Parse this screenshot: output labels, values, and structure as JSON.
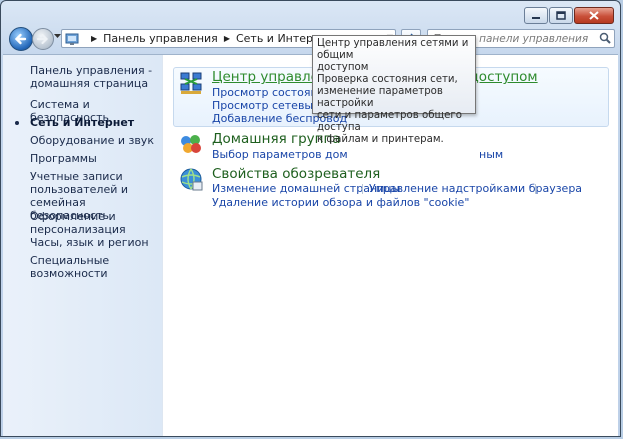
{
  "window": {
    "caption_buttons": [
      "minimize-icon",
      "maximize-icon",
      "close-icon"
    ]
  },
  "nav": {
    "breadcrumbs": [
      "Панель управления",
      "Сеть и Интернет"
    ],
    "search_placeholder": "Поиск в панели управления",
    "icons": [
      "back-arrow-icon",
      "forward-arrow-icon",
      "refresh-icon",
      "search-icon",
      "control-panel-icon"
    ]
  },
  "sidebar": {
    "items": [
      {
        "label": "Панель управления -",
        "label2": "домашняя страница"
      },
      {
        "label": "Система и безопасность"
      },
      {
        "label": "Сеть и Интернет"
      },
      {
        "label": "Оборудование и звук"
      },
      {
        "label": "Программы"
      },
      {
        "label": "Учетные записи",
        "label2": "пользователей и семейная",
        "label3": "безопасность"
      },
      {
        "label": "Оформление и",
        "label2": "персонализация"
      },
      {
        "label": "Часы, язык и регион"
      },
      {
        "label": "Специальные возможности"
      }
    ],
    "active_index": 2
  },
  "sections": [
    {
      "title": "Центр управления сетями и общим доступом",
      "icon": "network-center-icon",
      "links": [
        "Просмотр состояния се",
        "Просмотр сетевых комп",
        "Добавление беспровод"
      ]
    },
    {
      "title": "Домашняя группа",
      "icon": "homegroup-icon",
      "links": [
        "Выбор параметров дом",
        "ным"
      ]
    },
    {
      "title": "Свойства обозревателя",
      "icon": "internet-options-icon",
      "links": [
        "Изменение домашней страницы",
        "Управление надстройками браузера",
        "Удаление истории обзора и файлов \"cookie\""
      ]
    }
  ],
  "tooltip": {
    "lines": [
      "Центр управления сетями и общим",
      "доступом",
      "Проверка состояния сети,",
      "изменение параметров настройки",
      "сети и параметров общего доступа",
      "к файлам и принтерам."
    ]
  },
  "colors": {
    "link": "#1a46a8",
    "section_title": "#1e5f1e",
    "hover_title": "#2e8b2e",
    "sidebar_bg": "#e2ecf8"
  }
}
